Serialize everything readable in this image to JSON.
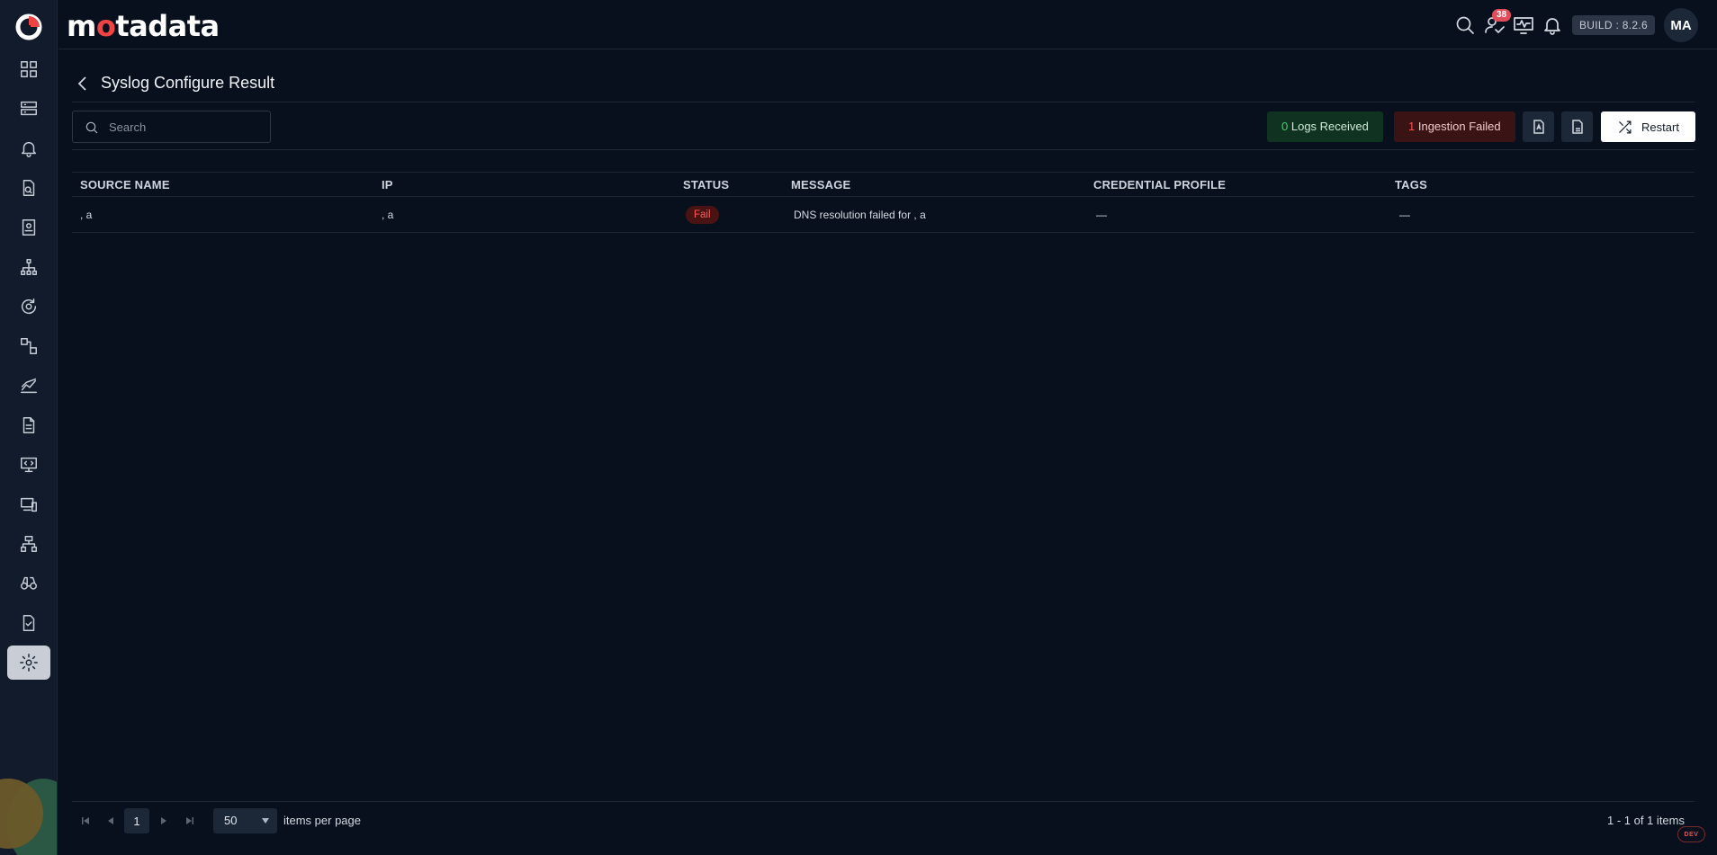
{
  "app": {
    "brand_prefix": "m",
    "brand_dot": "o",
    "brand_suffix": "tadata"
  },
  "header": {
    "notification_count": "38",
    "build": "BUILD : 8.2.6",
    "avatar_initials": "MA"
  },
  "sidebar": {
    "items": [
      {
        "icon": "dashboard-icon"
      },
      {
        "icon": "server-icon"
      },
      {
        "icon": "bell-icon"
      },
      {
        "icon": "file-search-icon"
      },
      {
        "icon": "report-icon"
      },
      {
        "icon": "topology-icon"
      },
      {
        "icon": "refresh-cycle-icon"
      },
      {
        "icon": "workflow-icon"
      },
      {
        "icon": "metrics-chart-icon"
      },
      {
        "icon": "document-icon"
      },
      {
        "icon": "code-monitor-icon"
      },
      {
        "icon": "devices-icon"
      },
      {
        "icon": "network-icon"
      },
      {
        "icon": "binoculars-icon"
      },
      {
        "icon": "checklist-icon"
      },
      {
        "icon": "settings-icon",
        "active": true
      }
    ]
  },
  "page": {
    "title": "Syslog Configure Result",
    "search_placeholder": "Search"
  },
  "stats": {
    "received_count": "0",
    "received_label": "Logs Received",
    "failed_count": "1",
    "failed_label": "Ingestion Failed",
    "ok_color": "#3ecf6e",
    "fail_color": "#ff4d4d"
  },
  "toolbar": {
    "restart_label": "Restart"
  },
  "table": {
    "columns": [
      "SOURCE NAME",
      "IP",
      "STATUS",
      "MESSAGE",
      "CREDENTIAL PROFILE",
      "TAGS"
    ],
    "rows": [
      {
        "source_name": ", a",
        "ip": ", a",
        "status": "Fail",
        "message": "DNS resolution failed for , a",
        "credential_profile": "—",
        "tags": "—"
      }
    ]
  },
  "pagination": {
    "current_page": "1",
    "per_page": "50",
    "per_page_label": "items per page",
    "range": "1 - 1 of 1 items"
  },
  "env_badge": "DEV"
}
